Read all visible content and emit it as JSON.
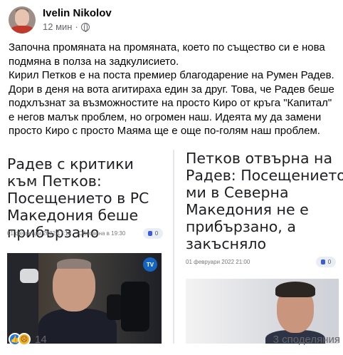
{
  "post": {
    "author": "Ivelin Nikolov",
    "time": "12 мин",
    "separator": "·",
    "privacy_icon": "globe-icon",
    "text": "Започна промяната на промяната, което по същество си е нова подмяна в полза на задкулисието.\nКирил Петков е на поста премиер благодарение на Румен Радев. Дори в деня на вота агитираха един за друг. Това, че Радев беше подхлъзнат за възможностите на просто Киро от кръга \"Капитал\" е негов малък проблем, но огромен наш. Идеята му да замени просто Киро с просто Маяма ще е още по-голям наш проблем."
  },
  "articles": [
    {
      "headline": "Радев с критики към Петков: Посещението в РС Македония беше прибързано",
      "date": "01 февруари 2022 17:18",
      "updated": "Обновена в 19:30",
      "comments": "0",
      "photo_badge": "TV"
    },
    {
      "headline": "Петков отвърна на Радев: Посещението ми в Северна Македония не е прибързано, а закъсняло",
      "date": "01 февруари 2022 21:00",
      "comments": "0"
    }
  ],
  "footer": {
    "reactions": [
      "like-icon",
      "sad-icon"
    ],
    "reaction_count": "14",
    "shares": "3 споделяния"
  },
  "colors": {
    "secondary_text": "#65676b",
    "like_blue": "#1877f2",
    "sad_yellow": "#f7b125"
  }
}
